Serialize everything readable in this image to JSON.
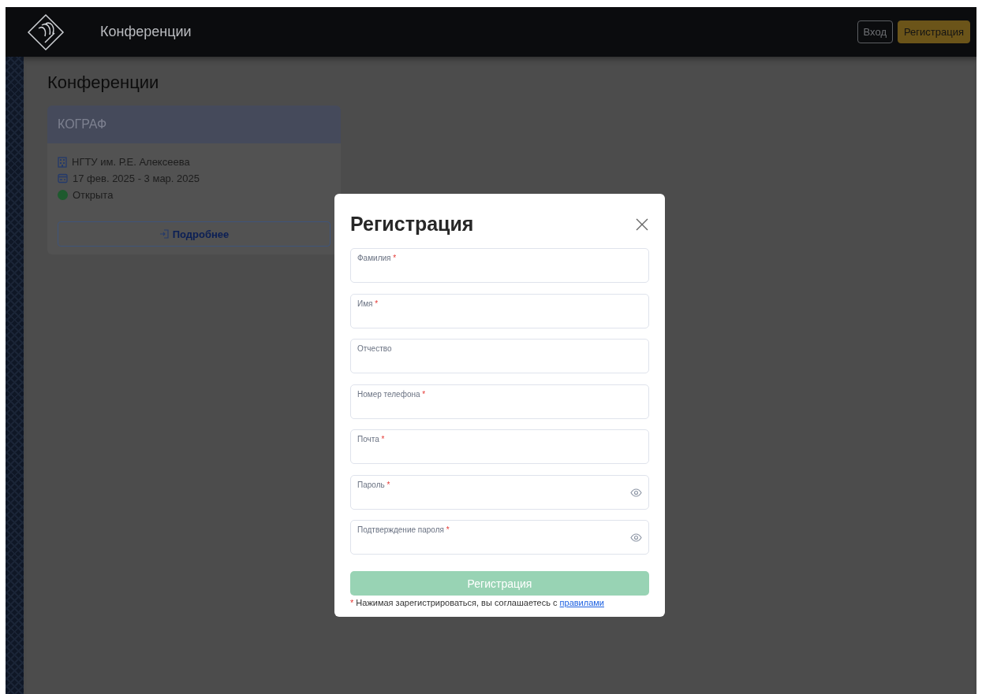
{
  "header": {
    "title": "Конференции",
    "buttons": [
      {
        "label": "Вход",
        "kind": "outline"
      },
      {
        "label": "Регистрация",
        "kind": "primary"
      }
    ]
  },
  "page": {
    "title": "Конференции"
  },
  "cards": [
    {
      "title": "КОГРАФ",
      "place": "НГТУ им. Р.Е. Алексеева",
      "dates": "17 фев. 2025 - 3 мар. 2025",
      "status": "Открыта",
      "color": "#1e5a2e",
      "button": "Подробнее"
    }
  ],
  "modal": {
    "title": "Регистрация",
    "fields": [
      {
        "label": "Фамилия",
        "mark": "*",
        "kind": "text"
      },
      {
        "label": "Имя",
        "mark": "*",
        "kind": "text"
      },
      {
        "label": "Отчество",
        "kind": "text"
      },
      {
        "label": "Номер телефона",
        "mark": "*",
        "kind": "text"
      },
      {
        "label": "Почта",
        "mark": "*",
        "kind": "text"
      },
      {
        "label": "Пароль",
        "mark": "*",
        "kind": "password"
      },
      {
        "label": "Подтверждение пароля",
        "mark": "*",
        "kind": "password"
      }
    ],
    "submit": {
      "label": "Регистрация",
      "disabled": true
    },
    "note": {
      "mark": "*",
      "text": "Нажимая зарегистрироваться, вы соглашаетесь с",
      "link": "правилами"
    }
  }
}
